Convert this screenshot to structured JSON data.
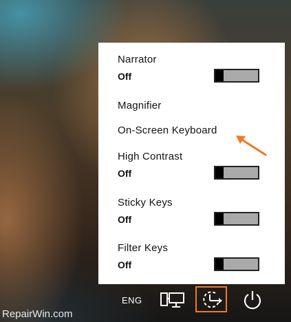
{
  "ease_of_access": {
    "narrator": {
      "label": "Narrator",
      "state": "Off"
    },
    "magnifier": {
      "label": "Magnifier"
    },
    "on_screen_keyboard": {
      "label": "On-Screen Keyboard"
    },
    "high_contrast": {
      "label": "High Contrast",
      "state": "Off"
    },
    "sticky_keys": {
      "label": "Sticky Keys",
      "state": "Off"
    },
    "filter_keys": {
      "label": "Filter Keys",
      "state": "Off"
    }
  },
  "taskbar": {
    "language": "ENG",
    "network_icon": "network-icon",
    "ease_of_access_icon": "ease-of-access-icon",
    "power_icon": "power-icon"
  },
  "watermark": "RepairWin.com",
  "colors": {
    "highlight": "#f07a22",
    "arrow": "#f07a22"
  }
}
